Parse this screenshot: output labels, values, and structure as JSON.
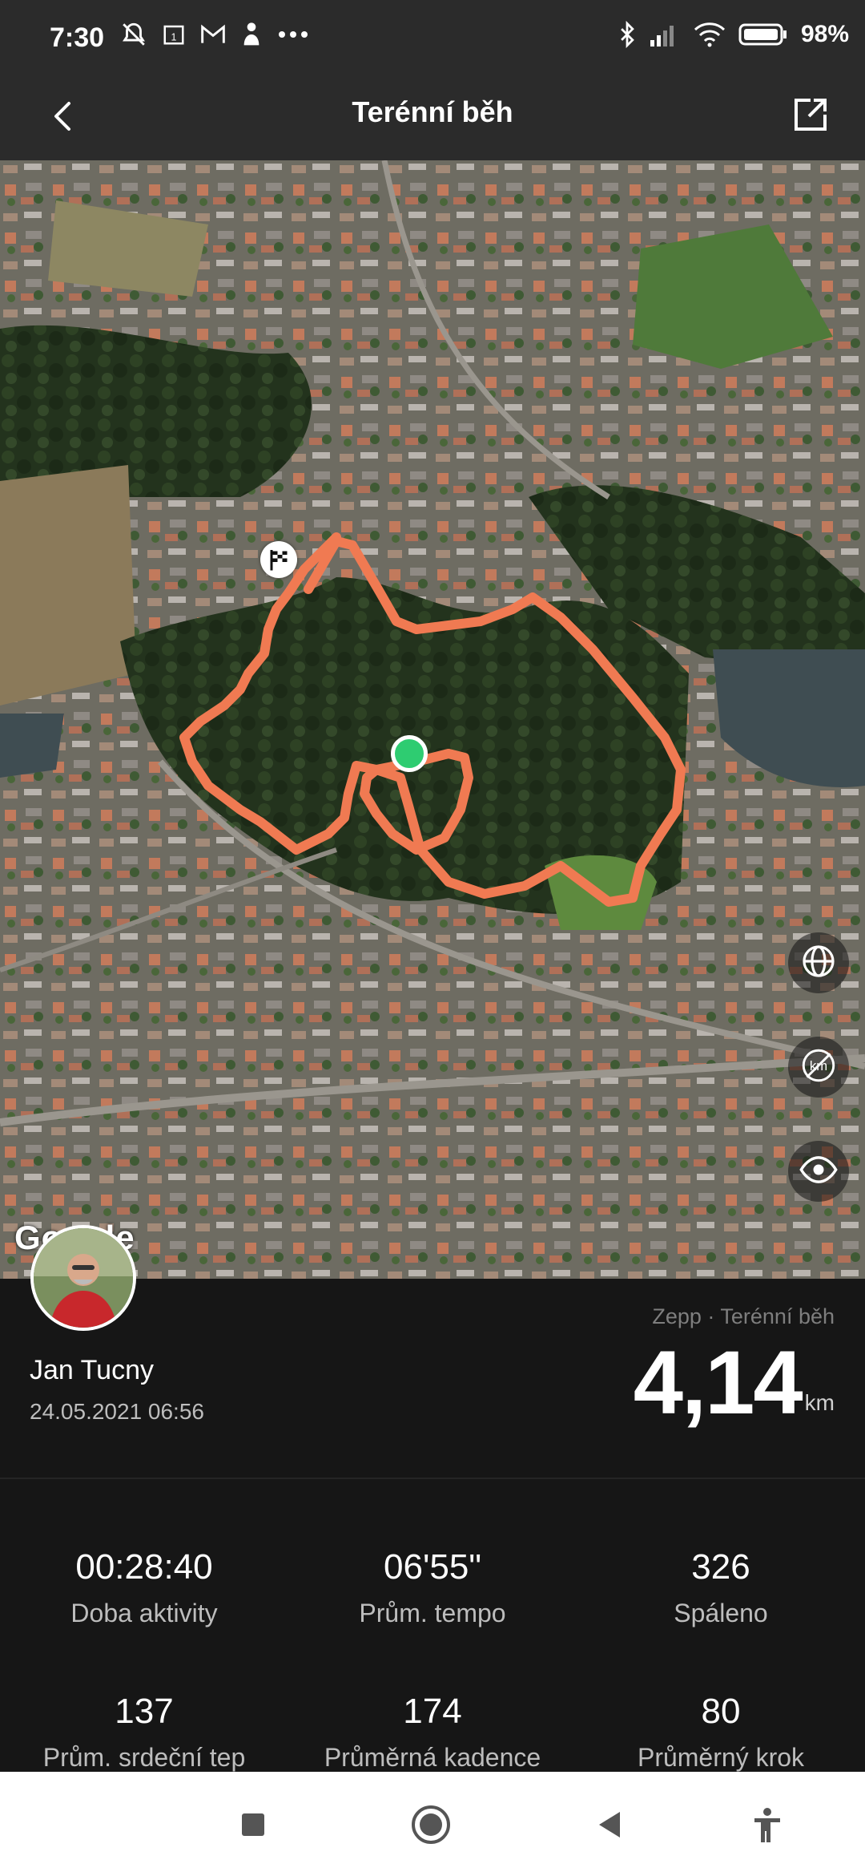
{
  "status_bar": {
    "time": "7:30",
    "battery": "98%"
  },
  "header": {
    "title": "Terénní běh"
  },
  "map": {
    "watermark": "Google"
  },
  "user": {
    "name": "Jan Tucny",
    "datetime": "24.05.2021 06:56"
  },
  "activity": {
    "source": "Zepp · Terénní běh",
    "distance": "4,14",
    "distance_unit": "km"
  },
  "stats": [
    {
      "value": "00:28:40",
      "label": "Doba aktivity"
    },
    {
      "value": "06'55\"",
      "label": "Prům. tempo"
    },
    {
      "value": "326",
      "label": "Spáleno"
    },
    {
      "value": "137",
      "label": "Prům. srdeční tep"
    },
    {
      "value": "174",
      "label": "Průměrná kadence"
    },
    {
      "value": "80",
      "label": "Průměrný krok"
    }
  ],
  "colors": {
    "route": "#f07a52",
    "start_marker": "#2ecc71",
    "background": "#161616"
  }
}
